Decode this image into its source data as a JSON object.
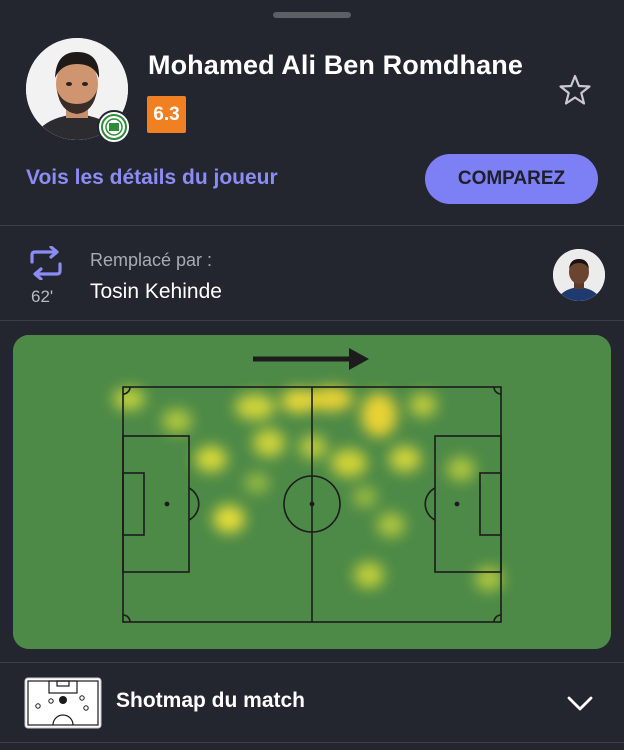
{
  "player": {
    "name": "Mohamed Ali Ben Romdhane",
    "rating": "6.3"
  },
  "actions": {
    "details_link": "Vois les détails du joueur",
    "compare_button": "COMPAREZ"
  },
  "substitution": {
    "minute": "62'",
    "label": "Remplacé par :",
    "player": "Tosin Kehinde"
  },
  "shotmap": {
    "label": "Shotmap du match"
  },
  "colors": {
    "background": "#23252f",
    "accent": "#8b8cf5",
    "button": "#7d7ff5",
    "rating_badge": "#f08022",
    "pitch": "#4d8a47"
  },
  "icons": [
    "star-icon",
    "substitution-icon",
    "arrow-right-icon",
    "shotmap-pitch-icon",
    "chevron-down-icon"
  ]
}
